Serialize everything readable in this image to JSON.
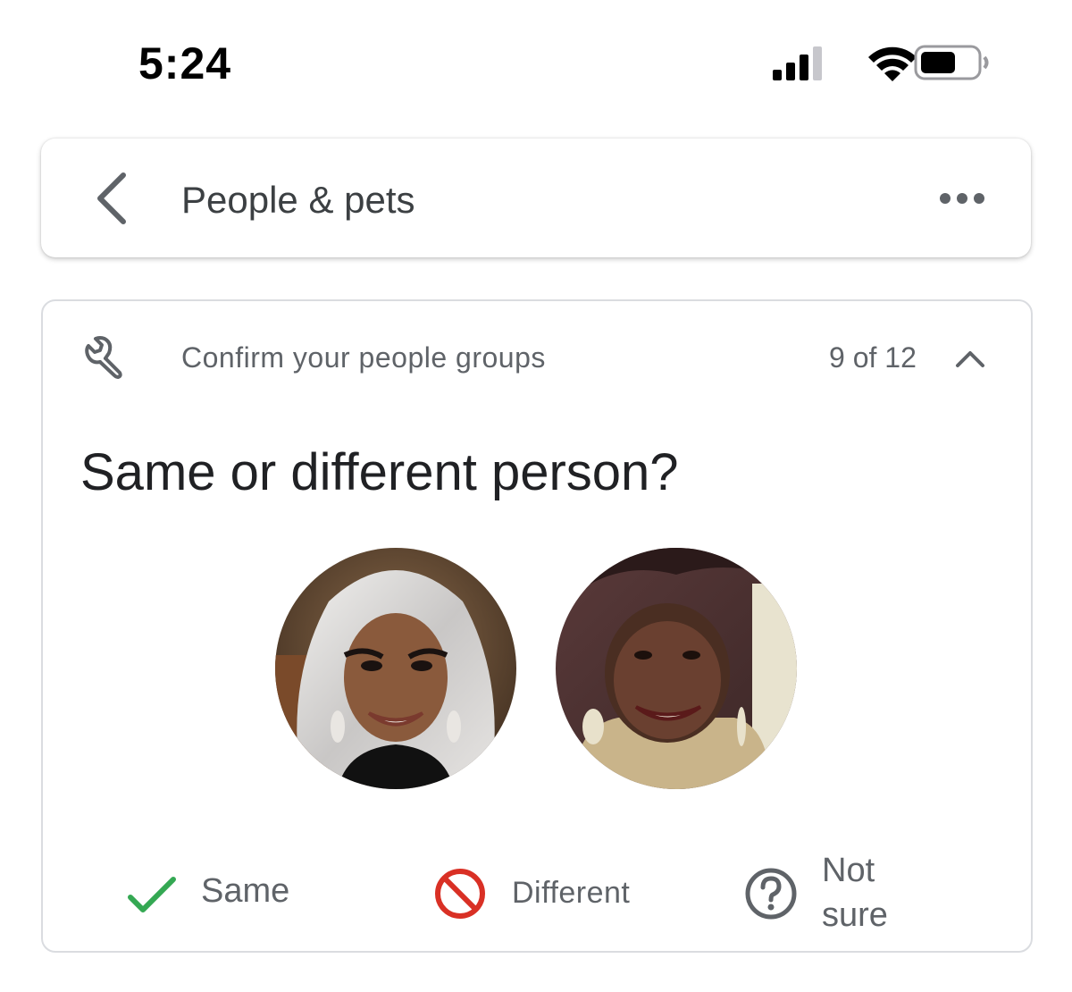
{
  "status_bar": {
    "time": "5:24",
    "signal_icon": "cellular-signal-icon",
    "wifi_icon": "wifi-icon",
    "battery_icon": "battery-icon"
  },
  "app_bar": {
    "back_icon": "chevron-left-icon",
    "title": "People & pets",
    "more_icon": "more-horizontal-icon"
  },
  "card": {
    "icon": "wrench-icon",
    "heading": "Confirm your people groups",
    "counter": "9 of 12",
    "collapse_icon": "chevron-up-icon",
    "question": "Same or different person?",
    "faces": [
      {
        "kind": "face-photo"
      },
      {
        "kind": "face-photo"
      }
    ],
    "actions": {
      "same": {
        "label": "Same",
        "icon": "checkmark-icon",
        "color": "#34a853"
      },
      "different": {
        "label": "Different",
        "icon": "prohibited-icon",
        "color": "#d93025"
      },
      "not_sure": {
        "label_line1": "Not",
        "label_line2": "sure",
        "icon": "question-circle-icon",
        "color": "#5f6368"
      }
    }
  }
}
